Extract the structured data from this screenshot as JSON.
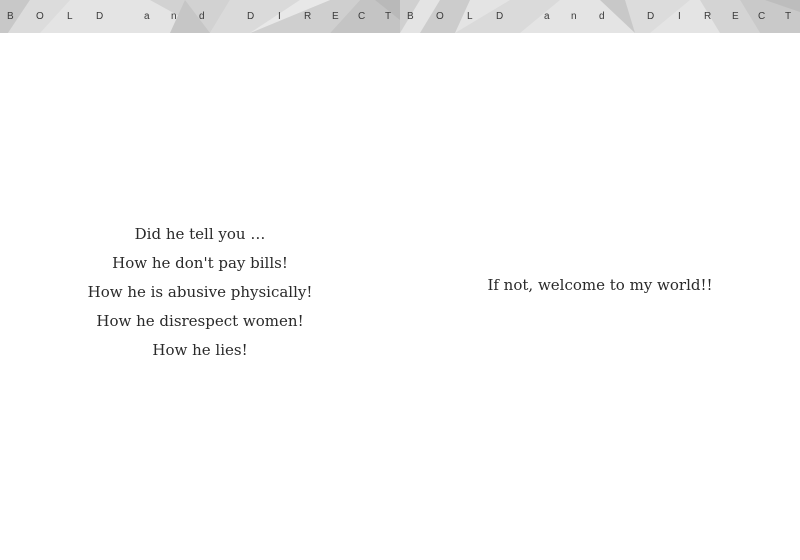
{
  "left_page": {
    "banner": {
      "letters": [
        "B",
        "O",
        "L",
        "D",
        "a",
        "n",
        "d",
        "D",
        "I",
        "R",
        "E",
        "C",
        "T"
      ]
    },
    "lines": [
      "Did he tell you …",
      "How he don't pay bills!",
      "How he is abusive physically!",
      "How he disrespect women!",
      "How he lies!"
    ]
  },
  "right_page": {
    "banner": {
      "letters": [
        "B",
        "O",
        "L",
        "D",
        "a",
        "n",
        "d",
        "D",
        "I",
        "R",
        "E",
        "C",
        "T"
      ]
    },
    "text": "If not, welcome to my world!!"
  },
  "colors": {
    "banner_bg": "#e4e4e4",
    "banner_facet_dark": "#c9c9c9",
    "banner_facet_mid": "#d6d6d6",
    "text": "#2a2a2a"
  }
}
